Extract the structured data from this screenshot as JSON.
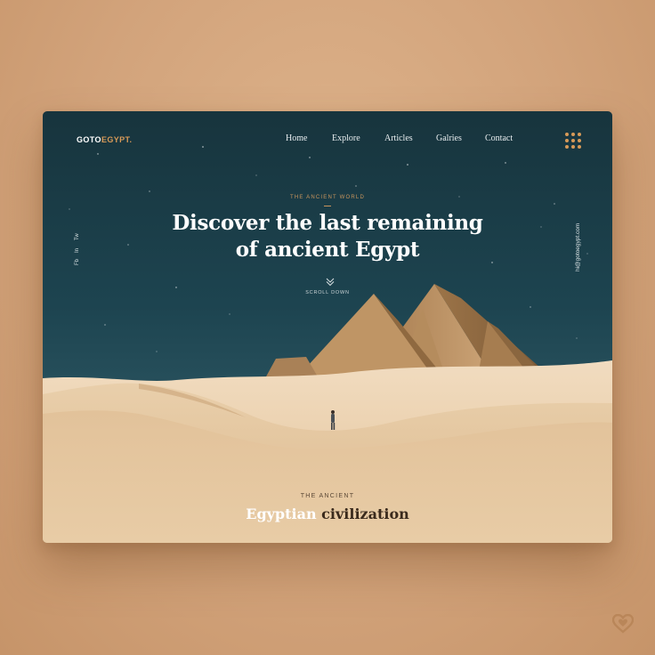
{
  "logo": {
    "part1": "GOTO",
    "part2": "EGYPT."
  },
  "nav": [
    "Home",
    "Explore",
    "Articles",
    "Galries",
    "Contact"
  ],
  "social": [
    "Fb",
    "In",
    "Tw"
  ],
  "contact_email": "hi@gotoegypt.com",
  "hero": {
    "eyebrow": "THE ANCIENT WORLD",
    "title_line1": "Discover the last remaining",
    "title_line2": "of ancient Egypt",
    "scroll_label": "SCROLL DOWN"
  },
  "section": {
    "eyebrow": "THE ANCIENT",
    "title_light": "Egyptian",
    "title_dark": "civilization"
  },
  "icons": {
    "menu": "grid-dots-icon",
    "scroll": "chevron-down-icon",
    "favorite": "heart-icon"
  },
  "colors": {
    "accent": "#d79a58",
    "sky_top": "#173b45",
    "sand": "#e6c9a0",
    "background": "#d2a37b"
  }
}
